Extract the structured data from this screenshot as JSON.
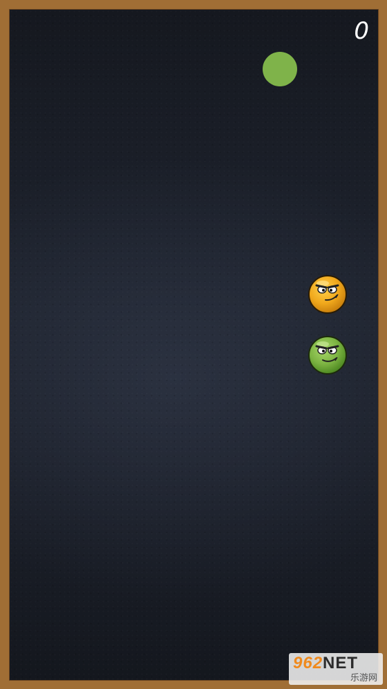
{
  "game": {
    "score": "0",
    "ball_color": "#7fb34a",
    "frame_color": "#a06e35",
    "background_color": "#1b1f28"
  },
  "characters": [
    {
      "name": "orange-face-ball",
      "color": "#e9a11a"
    },
    {
      "name": "green-face-ball",
      "color": "#7cb342"
    }
  ],
  "watermark": {
    "brand_num": "962",
    "brand_text": "NET",
    "subtitle": "乐游网"
  }
}
